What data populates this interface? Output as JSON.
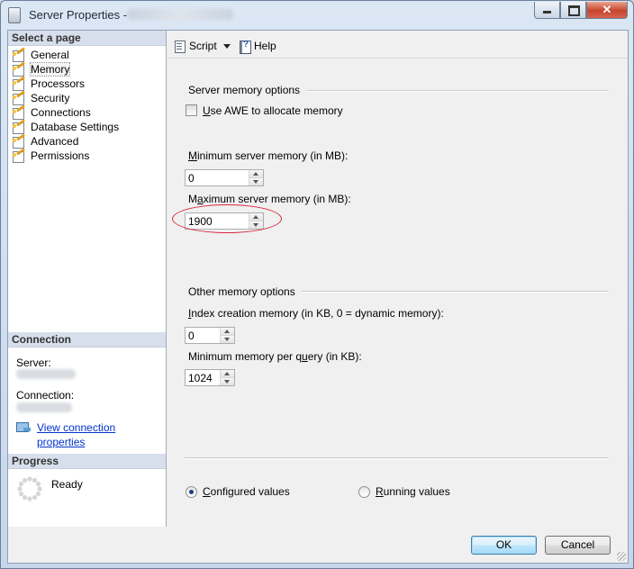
{
  "window": {
    "title": "Server Properties -"
  },
  "sidebar": {
    "select_header": "Select a page",
    "pages": [
      {
        "label": "General"
      },
      {
        "label": "Memory"
      },
      {
        "label": "Processors"
      },
      {
        "label": "Security"
      },
      {
        "label": "Connections"
      },
      {
        "label": "Database Settings"
      },
      {
        "label": "Advanced"
      },
      {
        "label": "Permissions"
      }
    ],
    "selected_page": "Memory",
    "connection_header": "Connection",
    "server_label": "Server:",
    "connection_label": "Connection:",
    "view_connection_link": "View connection properties",
    "progress_header": "Progress",
    "progress_status": "Ready"
  },
  "toolbar": {
    "script_label": "Script",
    "help_label": "Help"
  },
  "server_memory": {
    "group_label": "Server memory options",
    "awe_label": "Use AWE to allocate memory",
    "awe_checked": false,
    "min_label": "Minimum server memory (in MB):",
    "min_value": "0",
    "max_label": "Maximum server memory (in MB):",
    "max_value": "1900"
  },
  "other_memory": {
    "group_label": "Other memory options",
    "index_label": "Index creation memory (in KB, 0 = dynamic memory):",
    "index_value": "0",
    "min_query_label": "Minimum memory per query (in KB):",
    "min_query_value": "1024"
  },
  "values_mode": {
    "configured_label": "Configured values",
    "running_label": "Running values",
    "selected": "configured"
  },
  "buttons": {
    "ok_label": "OK",
    "cancel_label": "Cancel"
  },
  "colors": {
    "highlight_ellipse": "#d8283c",
    "link": "#0033cc",
    "section_header_bg": "#d6dfeb"
  }
}
